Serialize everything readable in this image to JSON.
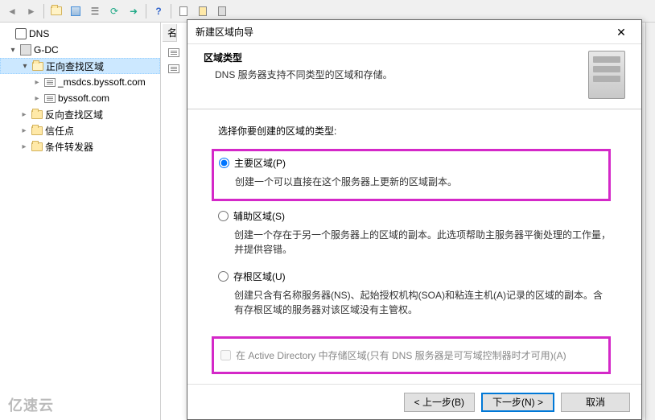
{
  "toolbar": {
    "icons": [
      "back",
      "forward",
      "up",
      "grid",
      "props",
      "refresh",
      "export",
      "help"
    ]
  },
  "tree": {
    "root": "DNS",
    "server": "G-DC",
    "fwd_zone": "正向查找区域",
    "zone1": "_msdcs.byssoft.com",
    "zone2": "byssoft.com",
    "rev_zone": "反向查找区域",
    "trust": "信任点",
    "cond_fwd": "条件转发器"
  },
  "content": {
    "col1": "名"
  },
  "dialog": {
    "title": "新建区域向导",
    "header_title": "区域类型",
    "header_sub": "DNS 服务器支持不同类型的区域和存储。",
    "prompt": "选择你要创建的区域的类型:",
    "opt1_label": "主要区域(P)",
    "opt1_desc": "创建一个可以直接在这个服务器上更新的区域副本。",
    "opt2_label": "辅助区域(S)",
    "opt2_desc": "创建一个存在于另一个服务器上的区域的副本。此选项帮助主服务器平衡处理的工作量，并提供容错。",
    "opt3_label": "存根区域(U)",
    "opt3_desc": "创建只含有名称服务器(NS)、起始授权机构(SOA)和粘连主机(A)记录的区域的副本。含有存根区域的服务器对该区域没有主管权。",
    "checkbox_label": "在 Active Directory 中存储区域(只有 DNS 服务器是可写域控制器时才可用)(A)",
    "btn_back": "< 上一步(B)",
    "btn_next": "下一步(N) >",
    "btn_cancel": "取消"
  },
  "watermark": "亿速云"
}
